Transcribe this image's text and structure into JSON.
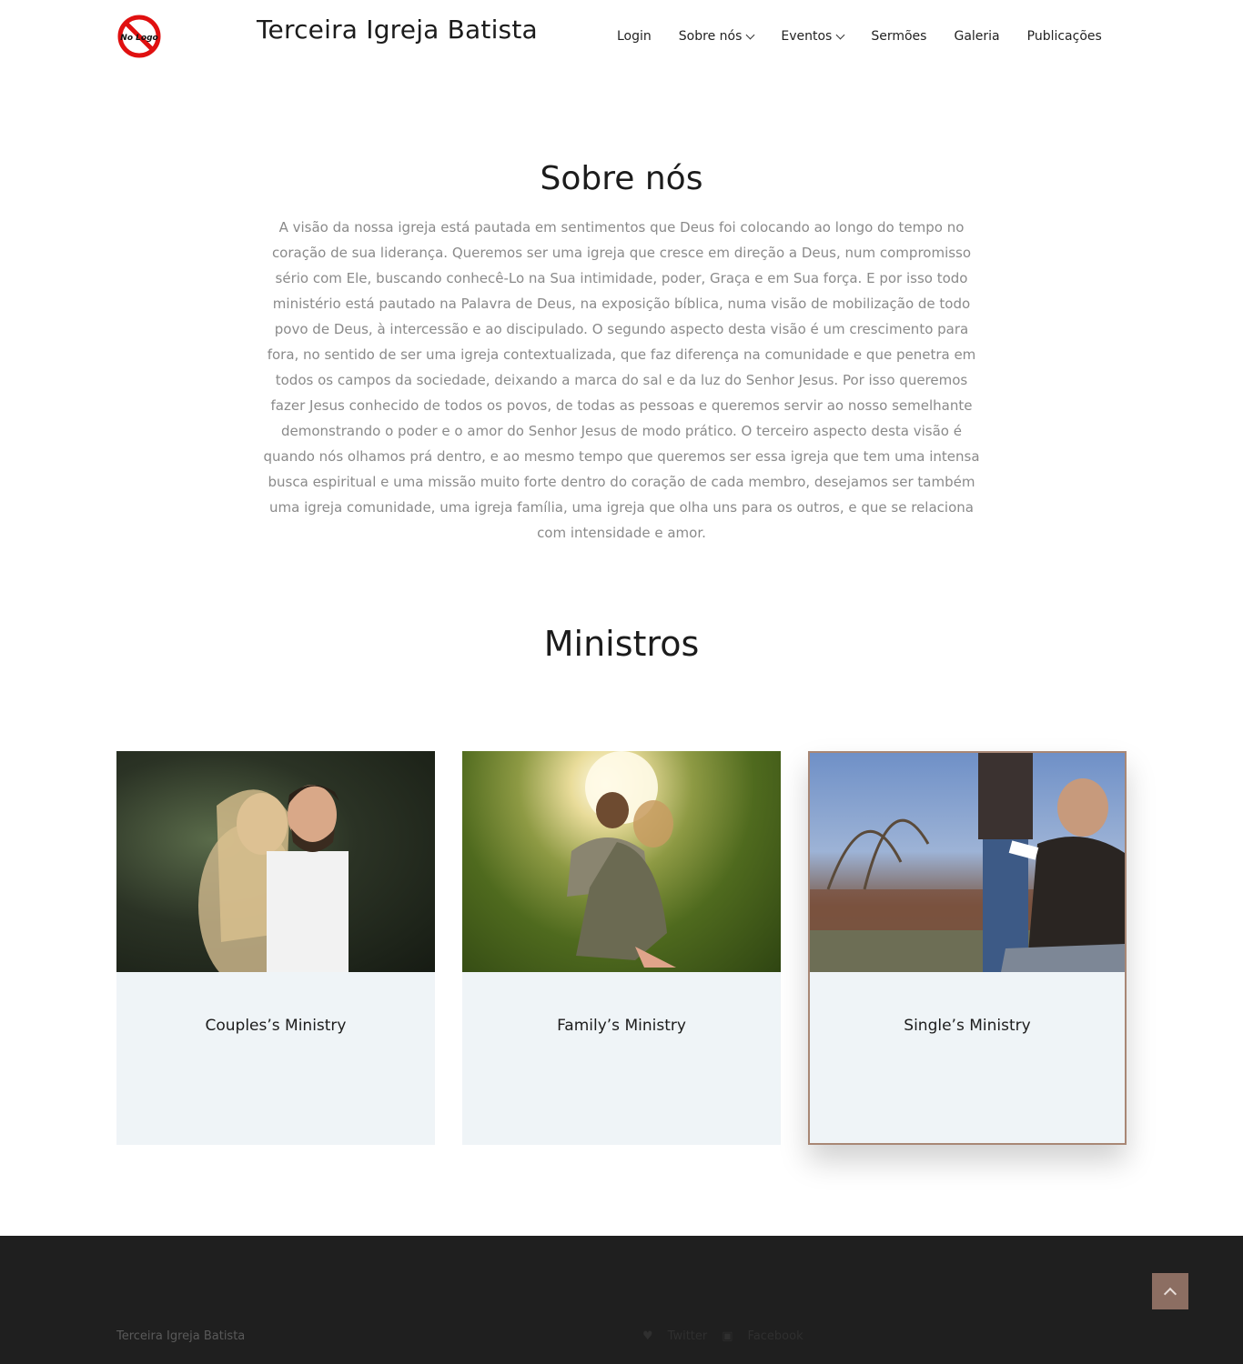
{
  "header": {
    "logo_text": "No Logo",
    "site_title": "Terceira Igreja Batista",
    "nav": [
      {
        "label": "Login",
        "dropdown": false
      },
      {
        "label": "Sobre nós",
        "dropdown": true
      },
      {
        "label": "Eventos",
        "dropdown": true
      },
      {
        "label": "Sermões",
        "dropdown": false
      },
      {
        "label": "Galeria",
        "dropdown": false
      },
      {
        "label": "Publicações",
        "dropdown": false
      }
    ]
  },
  "about": {
    "title": "Sobre nós",
    "text": "A visão da nossa igreja está pautada em sentimentos que Deus foi colocando ao longo do tempo no coração de sua liderança. Queremos ser uma igreja que cresce em direção a Deus, num compromisso sério com Ele, buscando conhecê-Lo na Sua intimidade, poder, Graça e em Sua força. E por isso todo ministério está pautado na Palavra de Deus, na exposição bíblica, numa visão de mobilização de todo povo de Deus, à intercessão e ao discipulado. O segundo aspecto desta visão é um crescimento para fora, no sentido de ser uma igreja contextualizada, que faz diferença na comunidade e que penetra em todos os campos da sociedade, deixando a marca do sal e da luz do Senhor Jesus. Por isso queremos fazer Jesus conhecido de todos os povos, de todas as pessoas e queremos servir ao nosso semelhante demonstrando o poder e o amor do Senhor Jesus de modo prático. O terceiro aspecto desta visão é quando nós olhamos prá dentro, e ao mesmo tempo que queremos ser essa igreja que tem uma intensa busca espiritual e uma missão muito forte dentro do coração de cada membro, desejamos ser também uma igreja comunidade, uma igreja família, uma igreja que olha uns para os outros, e que se relaciona com intensidade e amor."
  },
  "ministers": {
    "title": "Ministros",
    "cards": [
      {
        "label": "Couples’s Ministry"
      },
      {
        "label": "Family’s Ministry"
      },
      {
        "label": "Single’s Ministry"
      }
    ]
  },
  "footer": {
    "brand": "Terceira Igreja Batista",
    "social": [
      {
        "icon": "heart-icon",
        "label": "Twitter"
      },
      {
        "icon": "camera-icon",
        "label": "Facebook"
      }
    ]
  },
  "colors": {
    "accent": "#8c6e62",
    "card_bg": "#eff4f7",
    "footer_bg": "#1f1f1f",
    "body_text": "#8a8a8a"
  }
}
